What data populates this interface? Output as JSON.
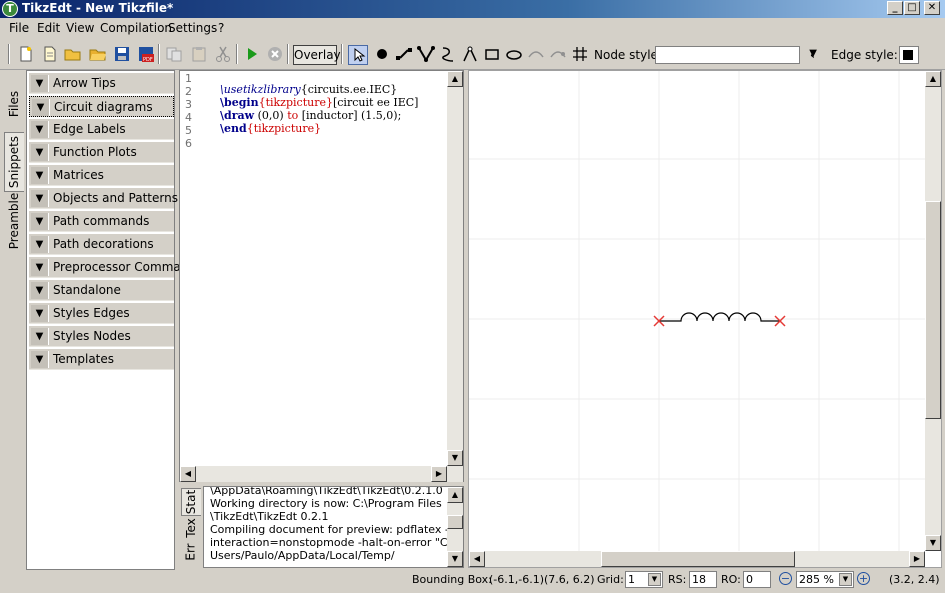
{
  "window": {
    "title": "TikzEdt - New Tikzfile*"
  },
  "menu": [
    "File",
    "Edit",
    "View",
    "Compilation",
    "Settings",
    "?"
  ],
  "toolbar": {
    "overlay_label": "Overlay",
    "node_style_label": "Node style:",
    "node_style_value": "",
    "edge_style_label": "Edge style:"
  },
  "side_tabs": [
    "Files",
    "Snippets",
    "Preamble"
  ],
  "snippets": [
    "Arrow Tips",
    "Circuit diagrams",
    "Edge Labels",
    "Function Plots",
    "Matrices",
    "Objects and Patterns",
    "Path commands",
    "Path decorations",
    "Preprocessor Commands",
    "Standalone",
    "Styles Edges",
    "Styles Nodes",
    "Templates"
  ],
  "editor": {
    "line_numbers": [
      "1",
      "2",
      "3",
      "4",
      "5",
      "6"
    ],
    "line2": {
      "cmd": "\\usetikzlibrary",
      "arg": "{circuits.ee.IEC}"
    },
    "line3": {
      "cmd": "\\begin",
      "env": "{tikzpicture}",
      "opts": "[circuit ee IEC]"
    },
    "line4": {
      "cmd": "\\draw",
      "a": " (0,0) ",
      "to": "to",
      "b": " [inductor] (1.5,0);"
    },
    "line5": {
      "cmd": "\\end",
      "env": "{tikzpicture}"
    }
  },
  "output_tabs": [
    "Stat",
    "Tex",
    "Err"
  ],
  "output_lines": [
    "\\AppData\\Roaming\\TikzEdt\\TikzEdt\\0.2.1.0",
    "Working directory is now: C:\\Program Files",
    "\\TikzEdt\\TikzEdt 0.2.1",
    "Compiling document for preview: pdflatex -",
    "interaction=nonstopmode -halt-on-error \"C:/",
    "Users/Paulo/AppData/Local/Temp/"
  ],
  "status": {
    "bbox_label": "Bounding Box:",
    "bbox_value": "(-6.1,-6.1)(7.6, 6.2)",
    "grid_label": "Grid:",
    "grid_value": "1",
    "rs_label": "RS:",
    "rs_value": "18",
    "ro_label": "RO:",
    "ro_value": "0",
    "zoom_value": "285 %",
    "coords": "(3.2, 2.4)"
  },
  "colors": {
    "marker": "#e53935",
    "keyword": "#00008b",
    "env": "#cc0000"
  }
}
